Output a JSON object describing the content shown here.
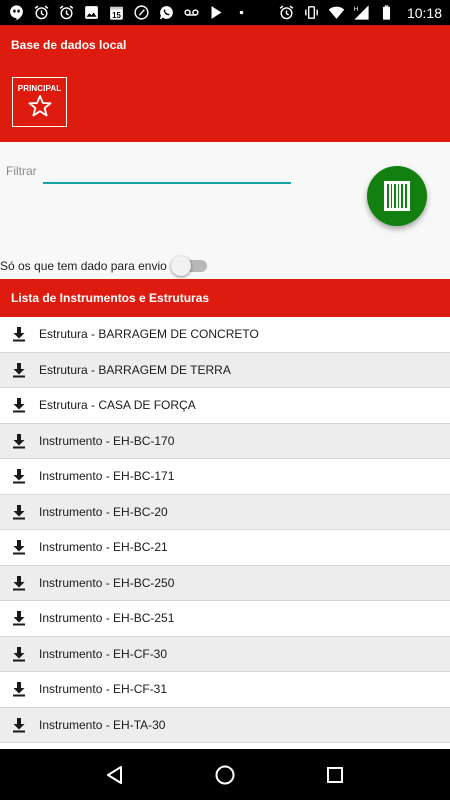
{
  "status_bar": {
    "time": "10:18",
    "left_icons": [
      "hangouts-icon",
      "alarm-icon",
      "alarm-icon",
      "gallery-icon",
      "calendar-icon",
      "music-icon",
      "whatsapp-icon",
      "voicemail-icon",
      "play-store-icon",
      "more-dots-icon"
    ],
    "calendar_day": "15",
    "right_icons": [
      "alarm-icon",
      "vibrate-icon",
      "wifi-icon",
      "signal-icon",
      "battery-icon"
    ],
    "network_label": "H"
  },
  "header": {
    "title": "Base de dados local",
    "principal_label": "PRINCIPAL"
  },
  "filter": {
    "label": "Filtrar",
    "value": "",
    "placeholder": ""
  },
  "toggle": {
    "label": "Só os que tem dado para envio",
    "checked": false
  },
  "list": {
    "header": "Lista de Instrumentos e Estruturas",
    "items": [
      {
        "label": "Estrutura - BARRAGEM DE CONCRETO"
      },
      {
        "label": "Estrutura - BARRAGEM DE TERRA"
      },
      {
        "label": "Estrutura - CASA DE FORÇA"
      },
      {
        "label": "Instrumento - EH-BC-170"
      },
      {
        "label": "Instrumento - EH-BC-171"
      },
      {
        "label": "Instrumento - EH-BC-20"
      },
      {
        "label": "Instrumento - EH-BC-21"
      },
      {
        "label": "Instrumento - EH-BC-250"
      },
      {
        "label": "Instrumento - EH-BC-251"
      },
      {
        "label": "Instrumento - EH-CF-30"
      },
      {
        "label": "Instrumento - EH-CF-31"
      },
      {
        "label": "Instrumento - EH-TA-30"
      }
    ]
  },
  "colors": {
    "primary_red": "#dd1c0f",
    "barcode_green": "#118010",
    "accent_teal": "#17a3a0"
  },
  "nav": [
    "back-icon",
    "home-icon",
    "recents-icon"
  ]
}
